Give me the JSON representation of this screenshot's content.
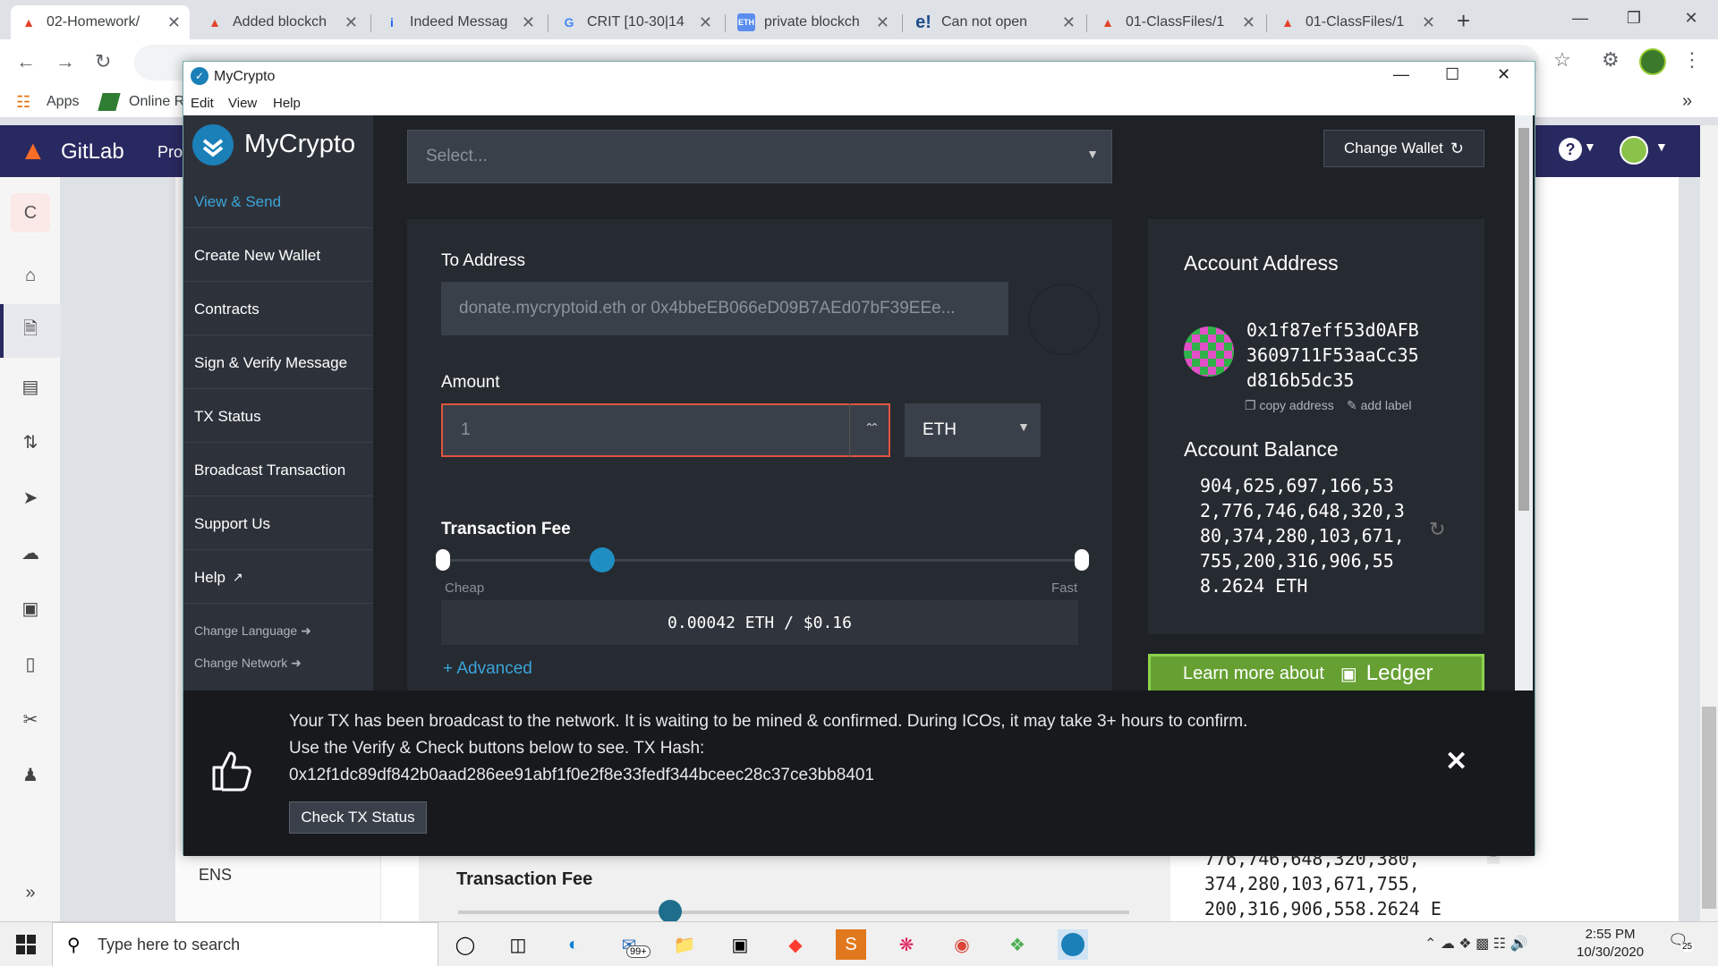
{
  "browser": {
    "tabs": [
      {
        "title": "02-Homework/",
        "active": true,
        "icon": "gitlab-icon"
      },
      {
        "title": "Added blockch",
        "icon": "gitlab-icon"
      },
      {
        "title": "Indeed Messag",
        "icon": "indeed-icon"
      },
      {
        "title": "CRIT [10-30|14",
        "icon": "google-icon"
      },
      {
        "title": "private blockch",
        "icon": "eth-icon"
      },
      {
        "title": "Can not open",
        "icon": "ethereum-se-icon"
      },
      {
        "title": "01-ClassFiles/1",
        "icon": "gitlab-icon"
      },
      {
        "title": "01-ClassFiles/1",
        "icon": "gitlab-icon"
      }
    ],
    "bookmarks": {
      "apps": "Apps",
      "online": "Online R"
    },
    "colors": {
      "chrome": "#dee1e6",
      "accent": "#1a73e8"
    }
  },
  "gitlab": {
    "brand": "GitLab",
    "nav_partial": "Pro",
    "project_initial": "C",
    "sub_ens": "ENS",
    "behind_fee_label": "Transaction Fee",
    "behind_balance": [
      "776,746,648,320,380,",
      "374,280,103,671,755,",
      "200,316,906,558.2624 E"
    ]
  },
  "app": {
    "window_title": "MyCrypto",
    "menu": [
      "Edit",
      "View",
      "Help"
    ],
    "logo": "MyCrypto",
    "sidebar": [
      {
        "label": "View & Send",
        "active": true
      },
      {
        "label": "Create New Wallet"
      },
      {
        "label": "Contracts"
      },
      {
        "label": "Sign & Verify Message"
      },
      {
        "label": "TX Status"
      },
      {
        "label": "Broadcast Transaction"
      },
      {
        "label": "Support Us"
      },
      {
        "label": "Help"
      }
    ],
    "sidebar_small": [
      "Change Language",
      "Change Network"
    ],
    "select_placeholder": "Select...",
    "change_wallet": "Change Wallet",
    "to_address_label": "To Address",
    "to_address_placeholder": "donate.mycryptoid.eth or 0x4bbeEB066eD09B7AEd07bF39EEe...",
    "amount_label": "Amount",
    "amount_placeholder": "1",
    "currency": "ETH",
    "fee_label": "Transaction Fee",
    "fee_cheap": "Cheap",
    "fee_fast": "Fast",
    "fee_level": 0.25,
    "fee_value": "0.00042 ETH / $0.16",
    "advanced": "+ Advanced",
    "account_address_label": "Account Address",
    "account_address_lines": [
      "0x1f87eff53d0AFB",
      "3609711F53aaCc35",
      "d816b5dc35"
    ],
    "copy_address": "copy address",
    "add_label": "add label",
    "account_balance_label": "Account Balance",
    "balance_lines": [
      "904,625,697,166,53",
      "2,776,746,648,320,3",
      "80,374,280,103,671,",
      "755,200,316,906,55",
      "8.2624 ETH"
    ],
    "ledger_banner": "Learn more about",
    "ledger_brand": "Ledger",
    "colors": {
      "bg": "#1e2126",
      "sidebar": "#2d323a",
      "link": "#3ba4d8",
      "error": "#e0543f",
      "ledger": "#66a033"
    }
  },
  "notification": {
    "line1": "Your TX has been broadcast to the network. It is waiting to be mined & confirmed. During ICOs, it may take 3+ hours to confirm.",
    "line2": "Use the Verify & Check buttons below to see. TX Hash:",
    "hash": "0x12f1dc89df842b0aad286ee91abf1f0e2f8e33fedf344bceec28c37ce3bb8401",
    "button": "Check TX Status"
  },
  "taskbar": {
    "search_placeholder": "Type here to search",
    "time": "2:55 PM",
    "date": "10/30/2020",
    "mail_badge": "99+",
    "notif_count": "25"
  }
}
